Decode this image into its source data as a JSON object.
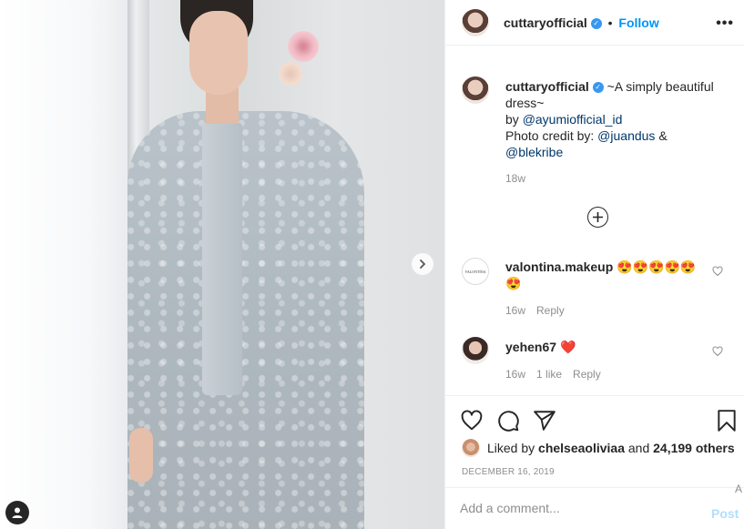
{
  "post": {
    "username": "cuttaryofficial",
    "follow_label": "Follow",
    "more_icon": "more-icon"
  },
  "caption": {
    "username": "cuttaryofficial",
    "line1": "~A simply beautiful",
    "line2": "dress~",
    "line3_prefix": "by ",
    "line3_mention": "@ayumiofficial_id",
    "line4_prefix": "Photo credit by: ",
    "line4_mention": "@juandus",
    "line4_suffix": " &",
    "line5_mention": "@blekribe",
    "time": "18w"
  },
  "comments": [
    {
      "avatar_text": "VALONTINA",
      "username": "valontina.makeup",
      "text_line1": "😍😍😍😍😍",
      "text_line2": "😍",
      "time": "16w",
      "likes": "",
      "reply": "Reply"
    },
    {
      "username": "yehen67",
      "text_line1": "❤️",
      "time": "16w",
      "likes": "1 like",
      "reply": "Reply"
    }
  ],
  "actions": {
    "liked_prefix": "Liked by ",
    "liked_user": "chelseaoliviaa",
    "liked_middle": " and ",
    "liked_count": "24,199 others",
    "date": "DECEMBER 16, 2019"
  },
  "add_comment": {
    "placeholder": "Add a comment...",
    "post_label": "Post",
    "edge_char": "A"
  },
  "colors": {
    "accent": "#0095f6",
    "verified": "#3897f0",
    "heart": "#ed4956",
    "muted": "#8e8e8e"
  }
}
